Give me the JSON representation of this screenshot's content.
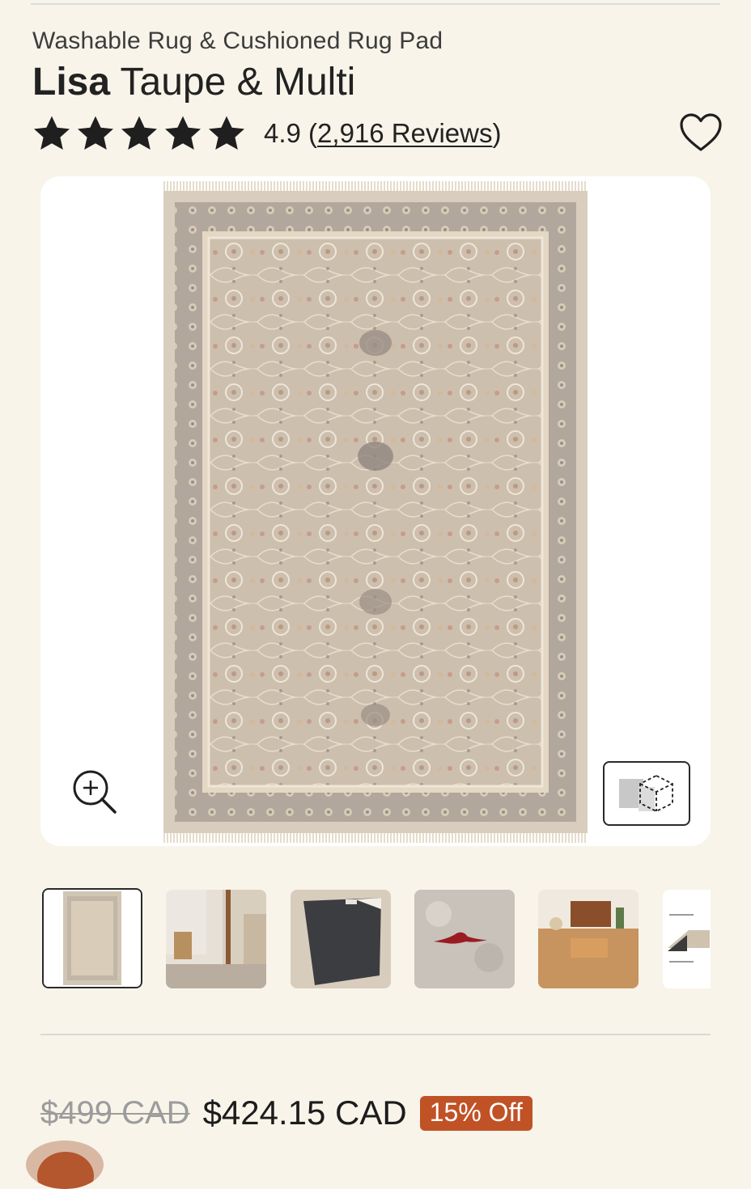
{
  "product": {
    "subtitle": "Washable Rug & Cushioned Rug Pad",
    "name_bold": "Lisa",
    "name_rest": " Taupe & Multi"
  },
  "rating": {
    "value": "4.9",
    "stars": 5,
    "reviews_text": "2,916 Reviews",
    "open_paren": "(",
    "close_paren": ")"
  },
  "gallery": {
    "thumbnails": [
      {
        "kind": "rug-flat",
        "selected": true
      },
      {
        "kind": "bedroom-scene",
        "selected": false
      },
      {
        "kind": "rug-pad",
        "selected": false
      },
      {
        "kind": "stain-closeup",
        "selected": false
      },
      {
        "kind": "living-room-floor",
        "selected": false
      },
      {
        "kind": "layers-diagram",
        "selected": false
      }
    ]
  },
  "pricing": {
    "original": "$499 CAD",
    "sale": "$424.15 CAD",
    "discount": "15% Off"
  },
  "colors": {
    "background": "#f8f4ea",
    "badge": "#c05226",
    "text": "#1f1f1f"
  },
  "icons": [
    "star-icon",
    "heart-icon",
    "zoom-in-icon",
    "3d-view-icon"
  ]
}
